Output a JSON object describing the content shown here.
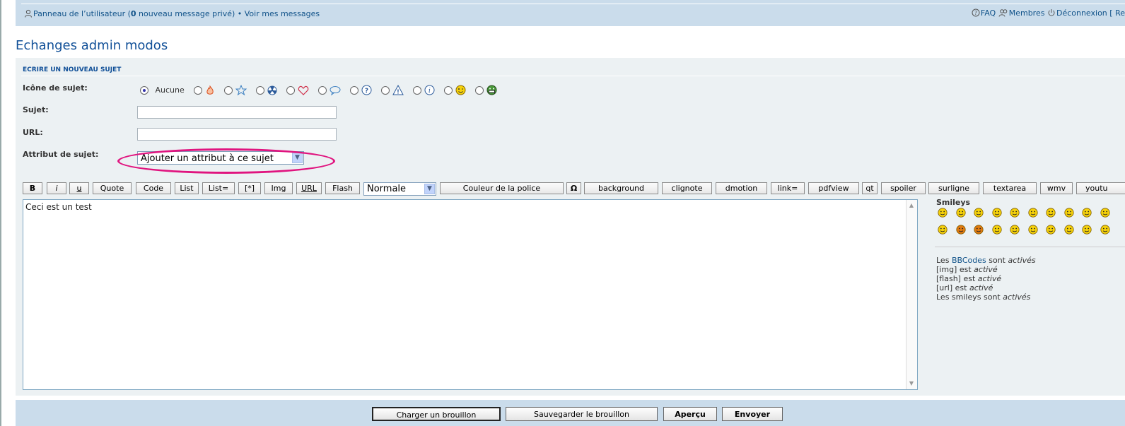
{
  "nav": {
    "ucp_text": "Panneau de l’utilisateur (",
    "ucp_count": "0",
    "ucp_suffix": " nouveau message privé) ",
    "bullet": "•",
    "view_messages": " Voir mes messages",
    "faq": "FAQ",
    "members": "Membres",
    "logout": "Déconnexion",
    "cut_link": "[ Re"
  },
  "page_title": "Echanges admin modos",
  "form": {
    "section_title": "ECRIRE UN NOUVEAU SUJET",
    "icon_label": "Icône de sujet:",
    "icon_none": "Aucune",
    "subject_label": "Sujet:",
    "subject_value": "",
    "url_label": "URL:",
    "url_value": "",
    "attribute_label": "Attribut de sujet:",
    "attribute_select": "Ajouter un attribut à ce sujet",
    "icons": [
      "fire-icon",
      "star-icon",
      "radioactive-icon",
      "heart-icon",
      "speech-bubble-icon",
      "question-icon",
      "warning-icon",
      "info-icon",
      "wink-smiley-icon",
      "grin-smiley-icon"
    ]
  },
  "toolbar": {
    "buttons": [
      "B",
      "i",
      "u",
      "Quote",
      "Code",
      "List",
      "List=",
      "[*]",
      "Img",
      "URL",
      "Flash"
    ],
    "font_size": "Normale",
    "color_button": "Couleur de la police",
    "omega": "Ω",
    "extra_buttons": [
      "background",
      "clignote",
      "dmotion",
      "link=",
      "pdfview",
      "qt",
      "spoiler",
      "surligne",
      "textarea",
      "wmv",
      "youtu"
    ]
  },
  "message_body": "Ceci est un test",
  "sidebar": {
    "smileys_title": "Smileys",
    "smileys": [
      {
        "name": "very-happy-smiley-icon",
        "color": "#f5d10a"
      },
      {
        "name": "smile-smiley-icon",
        "color": "#f5d10a"
      },
      {
        "name": "sad-smiley-icon",
        "color": "#f5d10a"
      },
      {
        "name": "surprised-smiley-icon",
        "color": "#f5d10a"
      },
      {
        "name": "shocked-smiley-icon",
        "color": "#f5d10a"
      },
      {
        "name": "confused-smiley-icon",
        "color": "#f5d10a"
      },
      {
        "name": "cool-smiley-icon",
        "color": "#f5d10a"
      },
      {
        "name": "laughing-smiley-icon",
        "color": "#f5d10a"
      },
      {
        "name": "mad-smiley-icon",
        "color": "#f5d10a"
      },
      {
        "name": "razz-smiley-icon",
        "color": "#f5d10a"
      },
      {
        "name": "embarrassed-smiley-icon",
        "color": "#f5d10a"
      },
      {
        "name": "evil-smiley-icon",
        "color": "#e07a10"
      },
      {
        "name": "twisted-smiley-icon",
        "color": "#e07a10"
      },
      {
        "name": "roll-eyes-smiley-icon",
        "color": "#f5d10a"
      },
      {
        "name": "wink-smiley-icon",
        "color": "#f5d10a"
      },
      {
        "name": "exclamation-smiley-icon",
        "color": "#f5d10a"
      },
      {
        "name": "question-smiley-icon",
        "color": "#f5d10a"
      },
      {
        "name": "idea-smiley-icon",
        "color": "#f5d10a"
      },
      {
        "name": "arrow-smiley-icon",
        "color": "#f5d10a"
      },
      {
        "name": "neutral-smiley-icon",
        "color": "#f5d10a"
      }
    ],
    "bbcode_prefix": "Les ",
    "bbcode_link": "BBCodes",
    "bbcode_mid": " sont ",
    "bbcode_state": "activés",
    "img_prefix": "[img] est ",
    "img_state": "activé",
    "flash_prefix": "[flash] est ",
    "flash_state": "activé",
    "url_prefix": "[url] est ",
    "url_state": "activé",
    "smileys_prefix": "Les smileys sont ",
    "smileys_state": "activés"
  },
  "actions": {
    "load_draft": "Charger un brouillon",
    "save_draft": "Sauvegarder le brouillon",
    "preview": "Aperçu",
    "submit": "Envoyer"
  },
  "colors": {
    "nav_bg": "#cadceb",
    "panel_bg": "#ecf1f3",
    "link": "#105289",
    "title": "#115098",
    "highlight_ellipse": "#e0147f"
  }
}
